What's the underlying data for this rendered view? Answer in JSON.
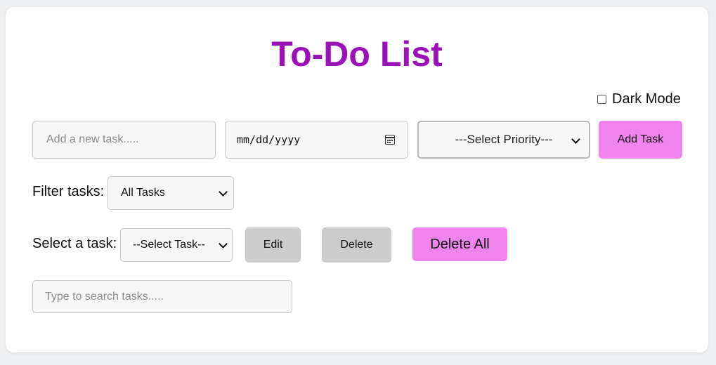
{
  "title": "To-Do List",
  "dark_mode": {
    "label": "Dark Mode",
    "checked": false
  },
  "task_input": {
    "placeholder": "Add a new task.....",
    "value": ""
  },
  "date_input": {
    "value": "mm/dd/yyyy",
    "icon": "calendar-icon"
  },
  "priority_select": {
    "selected": "---Select Priority---"
  },
  "add_button": {
    "label": "Add Task"
  },
  "filter": {
    "label": "Filter tasks:",
    "selected": "All Tasks"
  },
  "task_picker": {
    "label": "Select a task:",
    "selected": "--Select Task--"
  },
  "edit_button": {
    "label": "Edit"
  },
  "delete_button": {
    "label": "Delete"
  },
  "delete_all_button": {
    "label": "Delete All"
  },
  "search_input": {
    "placeholder": "Type to search tasks.....",
    "value": ""
  },
  "colors": {
    "title": "#9b10b8",
    "accent_button": "#ee84ec",
    "secondary_button": "#cccccc"
  }
}
